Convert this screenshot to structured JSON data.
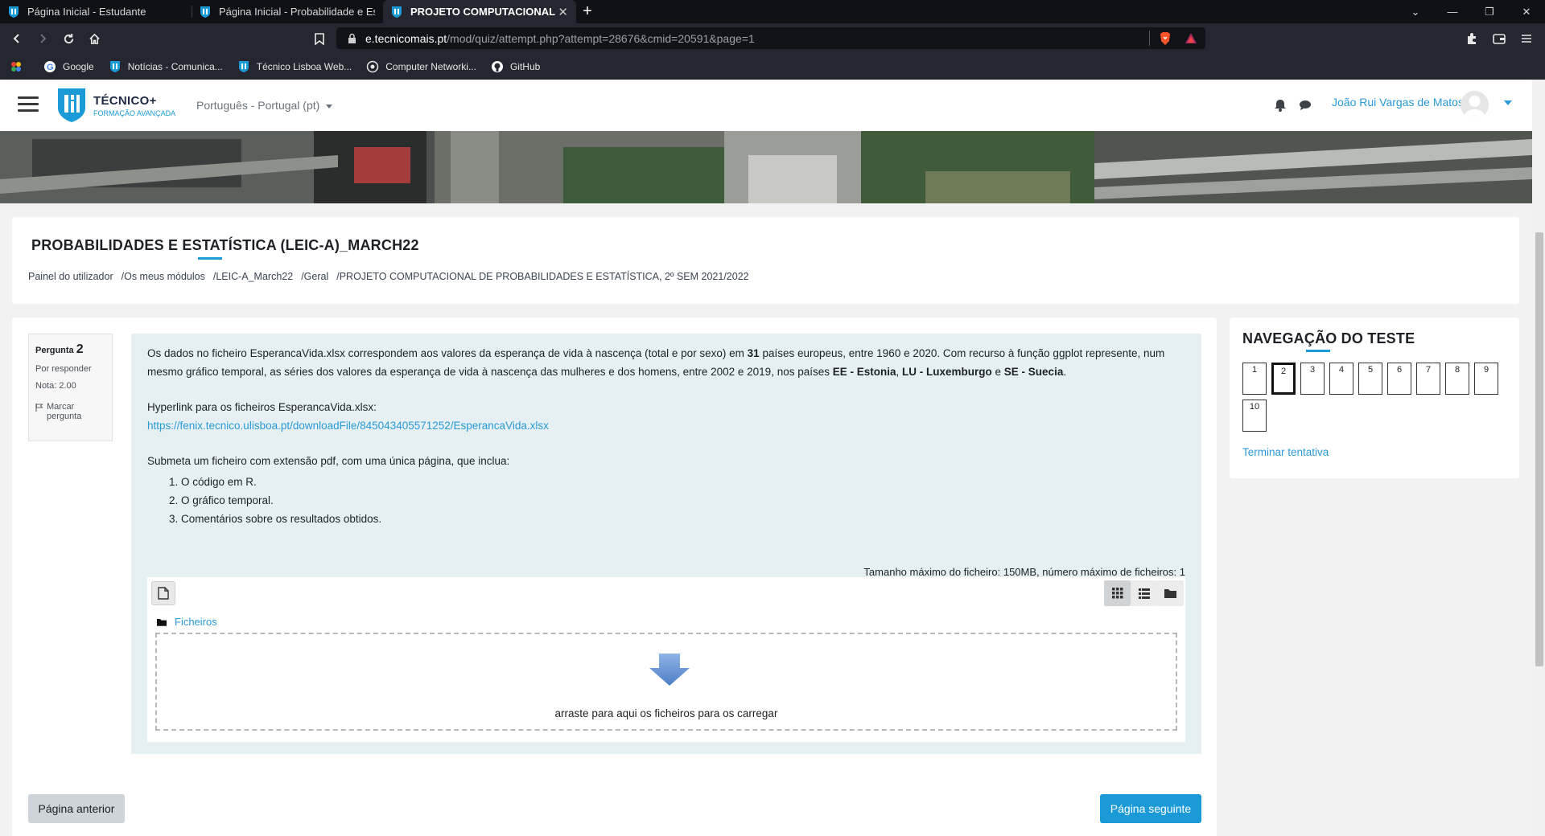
{
  "browser": {
    "tabs": [
      {
        "title": "Página Inicial - Estudante",
        "active": false
      },
      {
        "title": "Página Inicial - Probabilidade e Estatíst",
        "active": false
      },
      {
        "title": "PROJETO COMPUTACIONAL DE P",
        "active": true
      }
    ],
    "url_host": "e.tecnicomais.pt",
    "url_path": "/mod/quiz/attempt.php?attempt=28676&cmid=20591&page=1",
    "bookmarks": [
      {
        "label": "Google",
        "icon": "google-icon"
      },
      {
        "label": "Notícias - Comunica...",
        "icon": "ist-icon"
      },
      {
        "label": "Técnico Lisboa Web...",
        "icon": "ist-icon"
      },
      {
        "label": "Computer Networki...",
        "icon": "globe-icon"
      },
      {
        "label": "GitHub",
        "icon": "github-icon"
      }
    ]
  },
  "header": {
    "logo_line1": "TÉCNICO+",
    "logo_line2": "FORMAÇÃO AVANÇADA",
    "language": "Português - Portugal (pt)",
    "user_name": "João Rui Vargas de Matos"
  },
  "course": {
    "title": "PROBABILIDADES E ESTATÍSTICA (LEIC-A)_MARCH22",
    "breadcrumb": [
      "Painel do utilizador",
      "/Os meus módulos",
      "/LEIC-A_March22",
      "/Geral",
      "/PROJETO COMPUTACIONAL DE PROBABILIDADES E ESTATÍSTICA, 2º SEM 2021/2022"
    ]
  },
  "question": {
    "label": "Pergunta",
    "number": "2",
    "status": "Por responder",
    "grade": "Nota: 2.00",
    "flag_label": "Marcar pergunta",
    "para1_a": "Os dados no ficheiro EsperancaVida.xlsx correspondem aos valores da esperança de vida à nascença (total e por sexo) em ",
    "para1_b": "31",
    "para1_c": " países europeus, entre 1960 e 2020. Com recurso à função ggplot represente, num mesmo gráfico temporal, as séries dos valores da esperança de vida à nascença das mulheres e dos homens, entre 2002 e 2019, nos países ",
    "country1": "EE - Estonia",
    "sep1": ", ",
    "country2": "LU - Luxemburgo",
    "sep2": " e ",
    "country3": "SE - Suecia",
    "end": ".",
    "hyperlink_label": "Hyperlink para os ficheiros EsperancaVida.xlsx:",
    "hyperlink_url": "https://fenix.tecnico.ulisboa.pt/downloadFile/845043405571252/EsperancaVida.xlsx",
    "submit_text": "Submeta um ficheiro com extensão pdf, com uma única página, que inclua:",
    "items": [
      "O código em R.",
      "O gráfico temporal.",
      "Comentários sobre os resultados obtidos."
    ],
    "file_limits": "Tamanho máximo do ficheiro: 150MB, número máximo de ficheiros: 1",
    "files_folder": "Ficheiros",
    "drop_text": "arraste para aqui os ficheiros para os carregar"
  },
  "buttons": {
    "prev": "Página anterior",
    "next": "Página seguinte"
  },
  "quiz_nav": {
    "title": "NAVEGAÇÃO DO TESTE",
    "questions": [
      "1",
      "2",
      "3",
      "4",
      "5",
      "6",
      "7",
      "8",
      "9",
      "10"
    ],
    "current": "2",
    "finish": "Terminar tentativa"
  },
  "colors": {
    "accent": "#1a9ad6",
    "question_bg": "#e6f0f2",
    "browser_dark": "#24272f"
  }
}
